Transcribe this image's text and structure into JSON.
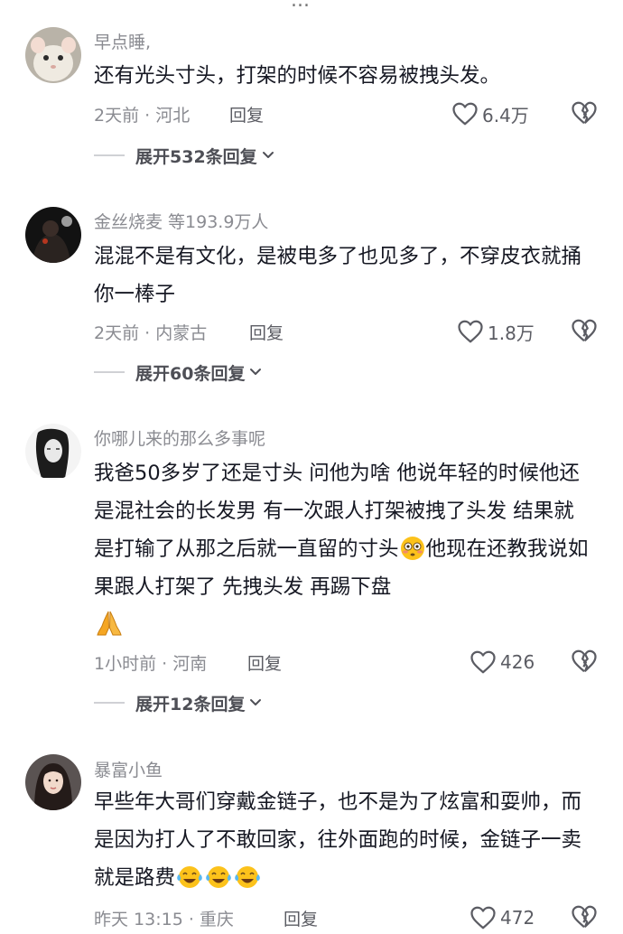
{
  "top_cut_text": "...",
  "comments": [
    {
      "username": "早点睡,",
      "text": "还有光头寸头，打架的时候不容易被拽头发。",
      "time_location": "2天前 · 河北",
      "reply_label": "回复",
      "likes": "6.4万",
      "expand_label": "展开532条回复",
      "avatar_icon": "white-rat-avatar"
    },
    {
      "username": "金丝烧麦 等193.9万人",
      "text": "混混不是有文化，是被电多了也见多了，不穿皮衣就捅你一棒子",
      "time_location": "2天前 · 内蒙古",
      "reply_label": "回复",
      "likes": "1.8万",
      "expand_label": "展开60条回复",
      "avatar_icon": "dark-night-avatar"
    },
    {
      "username": "你哪儿来的那么多事呢",
      "text": "我爸50多岁了还是寸头 问他为啥 他说年轻的时候他还是混社会的长发男 有一次跟人打架被拽了头发 结果就是打输了从那之后就一直留的寸头",
      "text_after_emoji": "他现在还教我说如果跟人打架了 先拽头发 再踢下盘",
      "time_location": "1小时前 · 河南",
      "reply_label": "回复",
      "likes": "426",
      "expand_label": "展开12条回复",
      "avatar_icon": "sketch-portrait-avatar",
      "emojis": [
        "flushed-face-emoji",
        "folded-hands-emoji"
      ]
    },
    {
      "username": "暴富小鱼",
      "text": "早些年大哥们穿戴金链子，也不是为了炫富和耍帅，而是因为打人了不敢回家，往外面跑的时候，金链子一卖就是路费",
      "time_location": "昨天 13:15 · 重庆",
      "reply_label": "回复",
      "likes": "472",
      "avatar_icon": "girl-portrait-avatar",
      "emojis": [
        "laughing-crying-emoji",
        "laughing-crying-emoji",
        "laughing-crying-emoji"
      ]
    }
  ],
  "icons": {
    "like": "heart-outline-icon",
    "dislike": "broken-heart-icon",
    "expand": "chevron-down-icon"
  },
  "colors": {
    "text": "#161823",
    "secondary": "#8a8b91",
    "action": "#5b5c63"
  }
}
